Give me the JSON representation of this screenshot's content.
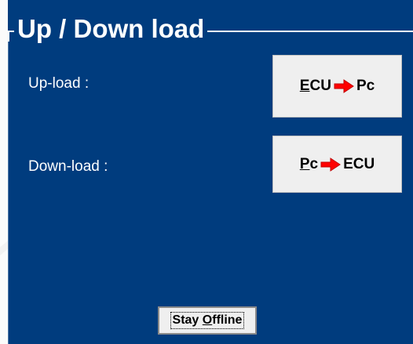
{
  "colors": {
    "panel_bg": "#003c7e",
    "text": "#ffffff",
    "button_bg": "#efefef",
    "arrow": "#ff0000"
  },
  "group": {
    "title": "Up / Down load"
  },
  "upload": {
    "label": "Up-load :",
    "button": {
      "mnemonic": "E",
      "from_rest": "CU",
      "to": "Pc",
      "icon": "red-right-arrow-icon"
    }
  },
  "download": {
    "label": "Down-load :",
    "button": {
      "mnemonic": "P",
      "from_rest": "c",
      "to": "ECU",
      "icon": "red-right-arrow-icon"
    }
  },
  "offline": {
    "prefix": "Stay ",
    "mnemonic": "O",
    "rest": "ffline"
  }
}
